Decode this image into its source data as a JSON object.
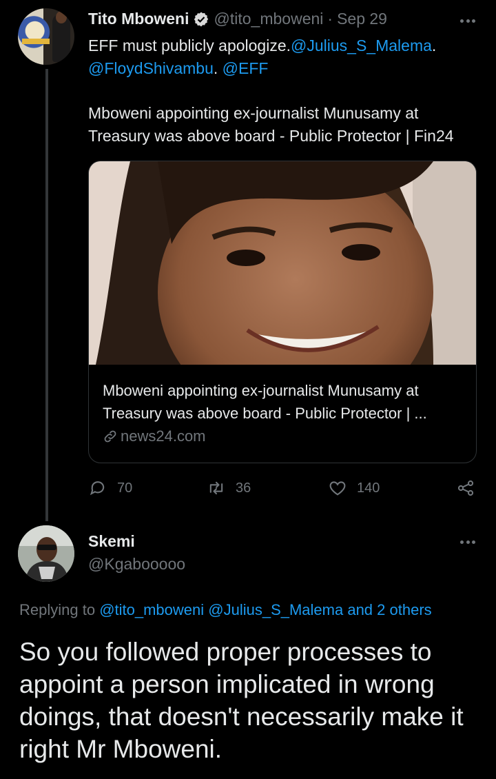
{
  "tweet": {
    "author_name": "Tito Mboweni",
    "author_handle": "@tito_mboweni",
    "separator": "·",
    "date": "Sep 29",
    "text_line1": "EFF must publicly apologize.",
    "mention_malema": "@Julius_S_Malema",
    "mention_malema_suffix": ".",
    "mention_floyd": "@FloydShivambu",
    "mention_floyd_suffix": ". ",
    "mention_eff": "@EFF",
    "headline": "Mboweni appointing ex-journalist Munusamy at Treasury was above board - Public Protector | Fin24",
    "card": {
      "title": "Mboweni appointing ex-journalist Munusamy at Treasury was above board - Public Protector | ...",
      "domain": "news24.com"
    },
    "actions": {
      "replies": "70",
      "retweets": "36",
      "likes": "140"
    }
  },
  "reply": {
    "author_name": "Skemi",
    "author_handle": "@Kgabooooo",
    "replying_prefix": "Replying to ",
    "replying_mentions": "@tito_mboweni @Julius_S_Malema and 2 others",
    "text": "So you followed proper processes to appoint a person implicated in wrong doings, that doesn't necessarily make it right Mr Mboweni."
  },
  "icons": [
    "verified-badge-icon",
    "more-icon",
    "link-icon",
    "reply-icon",
    "retweet-icon",
    "like-icon",
    "share-icon"
  ],
  "colors": {
    "background": "#000000",
    "text": "#e7e9ea",
    "muted": "#71767b",
    "link": "#1d9bf0"
  }
}
